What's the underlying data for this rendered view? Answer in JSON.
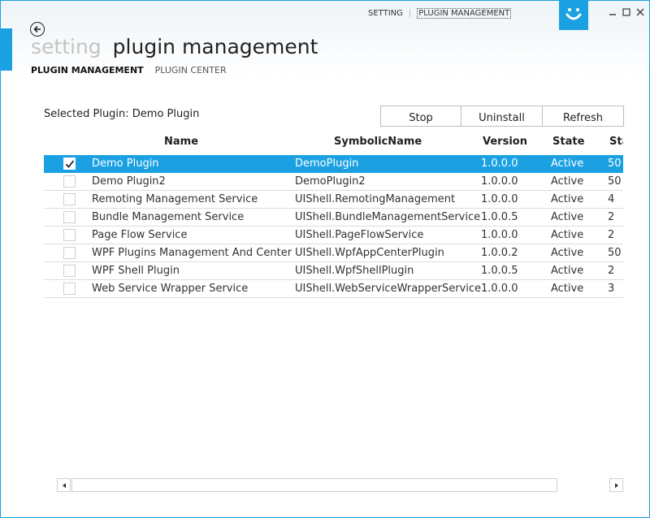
{
  "top_nav": {
    "setting": "SETTING",
    "current": "PLUGIN MANAGEMENT"
  },
  "icons": {
    "back": "back-arrow-icon",
    "logo": "smiley-logo-icon",
    "minimize": "minimize-icon",
    "maximize": "maximize-icon",
    "close": "close-icon",
    "check": "checkmark-icon",
    "scroll_left": "chevron-left-icon",
    "scroll_right": "chevron-right-icon"
  },
  "header": {
    "title_faint": "setting",
    "title_main": "plugin management"
  },
  "subnav": {
    "active": "PLUGIN MANAGEMENT",
    "inactive": "PLUGIN CENTER"
  },
  "selected_plugin_label": "Selected Plugin: Demo Plugin",
  "toolbar": {
    "stop": "Stop",
    "uninstall": "Uninstall",
    "refresh": "Refresh"
  },
  "table": {
    "columns": [
      "Name",
      "SymbolicName",
      "Version",
      "State",
      "Sta"
    ],
    "rows": [
      {
        "checked": true,
        "name": "Demo Plugin",
        "symbolic": "DemoPlugin",
        "version": "1.0.0.0",
        "state": "Active",
        "start": "50"
      },
      {
        "checked": false,
        "name": "Demo Plugin2",
        "symbolic": "DemoPlugin2",
        "version": "1.0.0.0",
        "state": "Active",
        "start": "50"
      },
      {
        "checked": false,
        "name": "Remoting Management Service",
        "symbolic": "UIShell.RemotingManagement",
        "version": "1.0.0.0",
        "state": "Active",
        "start": "4"
      },
      {
        "checked": false,
        "name": "Bundle Management Service",
        "symbolic": "UIShell.BundleManagementService",
        "version": "1.0.0.5",
        "state": "Active",
        "start": "2"
      },
      {
        "checked": false,
        "name": "Page Flow Service",
        "symbolic": "UIShell.PageFlowService",
        "version": "1.0.0.0",
        "state": "Active",
        "start": "2"
      },
      {
        "checked": false,
        "name": "WPF Plugins Management And Center",
        "symbolic": "UIShell.WpfAppCenterPlugin",
        "version": "1.0.0.2",
        "state": "Active",
        "start": "50"
      },
      {
        "checked": false,
        "name": "WPF Shell Plugin",
        "symbolic": "UIShell.WpfShellPlugin",
        "version": "1.0.0.5",
        "state": "Active",
        "start": "2"
      },
      {
        "checked": false,
        "name": "Web Service Wrapper Service",
        "symbolic": "UIShell.WebServiceWrapperService",
        "version": "1.0.0.0",
        "state": "Active",
        "start": "3"
      }
    ]
  },
  "colors": {
    "accent": "#1ba1e2",
    "selected_row_bg": "#1ba1e2",
    "faint_title": "#c4c4c4"
  }
}
